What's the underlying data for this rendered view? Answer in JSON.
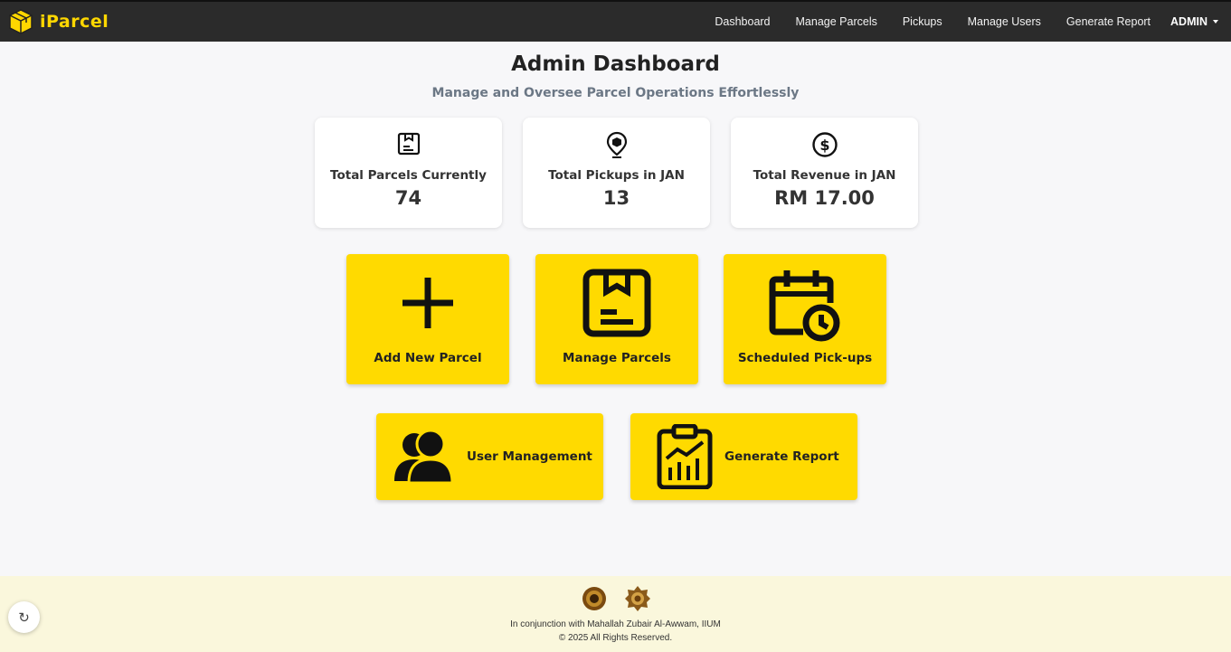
{
  "navbar": {
    "brand": "iParcel",
    "links": [
      "Dashboard",
      "Manage Parcels",
      "Pickups",
      "Manage Users",
      "Generate Report"
    ],
    "user": "ADMIN"
  },
  "header": {
    "title": "Admin Dashboard",
    "subtitle": "Manage and Oversee Parcel Operations Effortlessly"
  },
  "stats": [
    {
      "label": "Total Parcels Currently",
      "value": "74",
      "icon": "parcel-box-icon"
    },
    {
      "label": "Total Pickups in JAN",
      "value": "13",
      "icon": "location-pin-icon"
    },
    {
      "label": "Total Revenue in JAN",
      "value": "RM 17.00",
      "icon": "dollar-circle-icon"
    }
  ],
  "tiles": [
    {
      "label": "Add New Parcel",
      "icon": "plus-icon"
    },
    {
      "label": "Manage Parcels",
      "icon": "parcel-box-icon"
    },
    {
      "label": "Scheduled Pick-ups",
      "icon": "calendar-clock-icon"
    },
    {
      "label": "User Management",
      "icon": "users-icon"
    },
    {
      "label": "Generate Report",
      "icon": "clipboard-chart-icon"
    }
  ],
  "footer": {
    "line1": "In conjunction with Mahallah Zubair Al-Awwam, IIUM",
    "line2": "© 2025 All Rights Reserved."
  },
  "colors": {
    "navbar": "#2b2b2b",
    "brand": "#FFD700",
    "tile": "#FFDA00",
    "footer": "#faf7dc"
  }
}
